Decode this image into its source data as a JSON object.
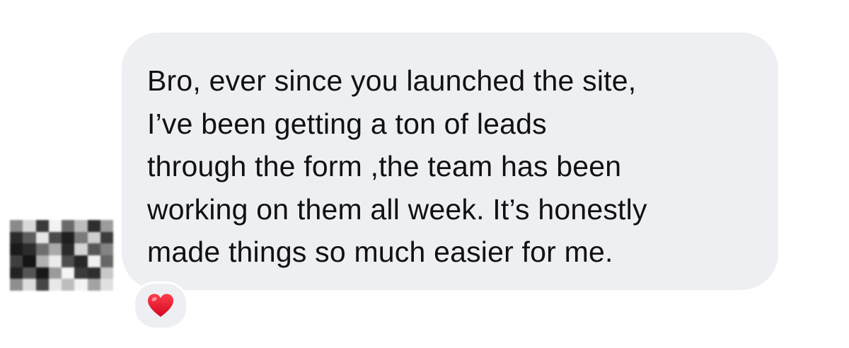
{
  "message": {
    "text": "Bro, ever since you launched the site,\nI’ve been getting a ton of leads\nthrough the form ,the team has been\nworking on them all week. It’s honestly\nmade things so much easier for me.",
    "bubble_color": "#eeeff3",
    "text_color": "#111111"
  },
  "reaction": {
    "icon": "red-heart-icon",
    "color": "#e8112d"
  },
  "avatar": {
    "blurred": true
  }
}
